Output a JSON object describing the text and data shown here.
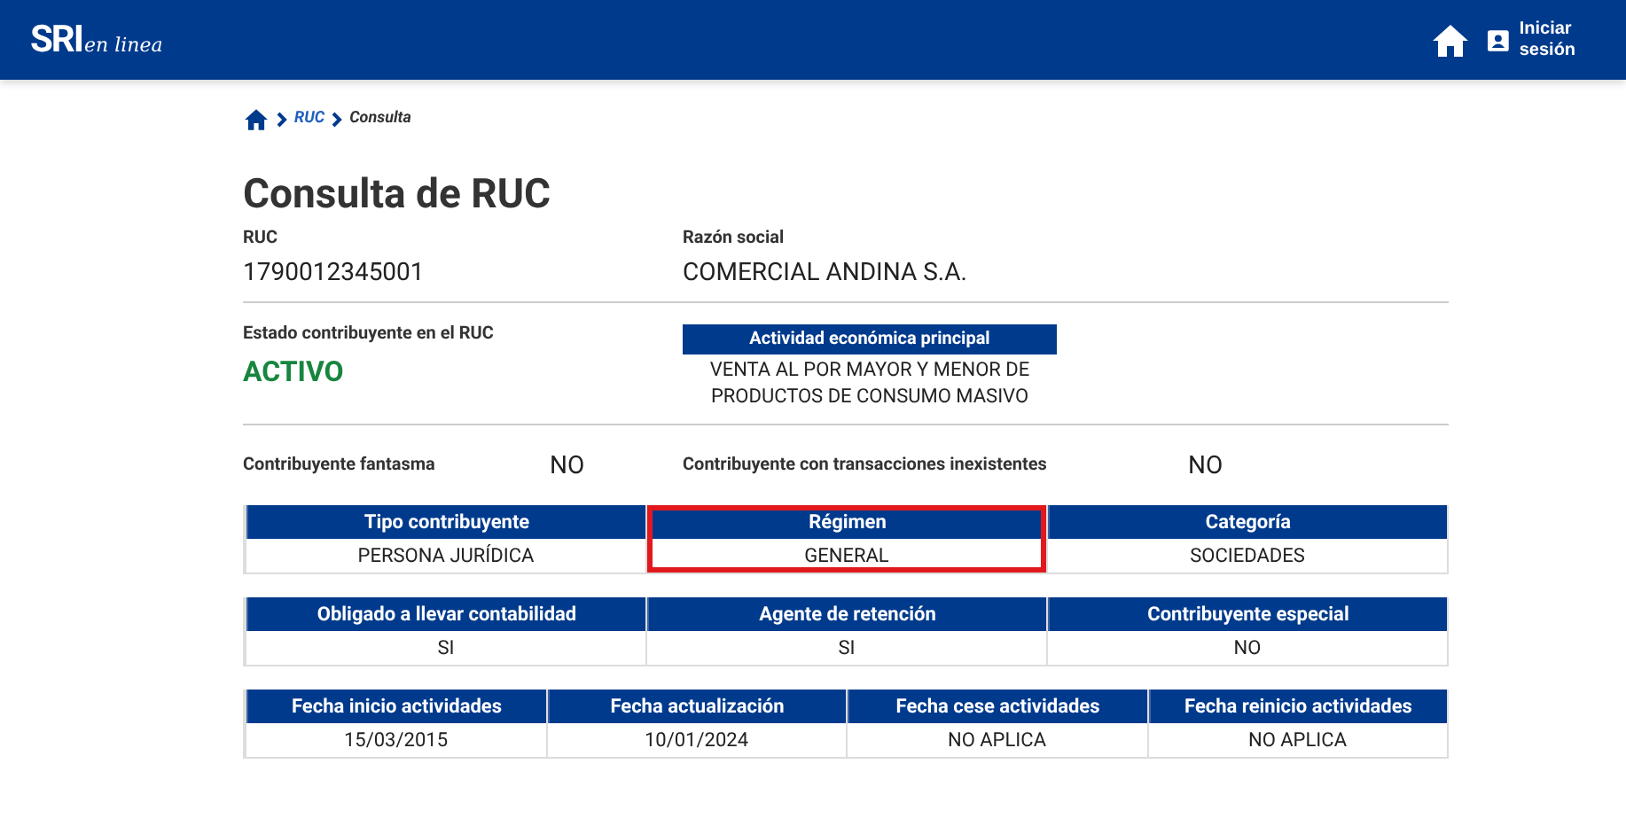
{
  "header": {
    "logo": "SRI",
    "logo_suffix": "en linea",
    "login": "Iniciar sesión"
  },
  "breadcrumb": [
    "RUC",
    "Consulta"
  ],
  "title": "Consulta de RUC",
  "ruc": {
    "label": "RUC",
    "value": "1790012345001"
  },
  "razon_social": {
    "label": "Razón social",
    "value": "COMERCIAL ANDINA S.A."
  },
  "estado": {
    "label": "Estado contribuyente en el RUC",
    "value": "ACTIVO"
  },
  "actividad": {
    "label": "Actividad económica principal",
    "value": "VENTA AL POR MAYOR Y MENOR DE PRODUCTOS DE CONSUMO MASIVO"
  },
  "flags": [
    {
      "label": "Contribuyente fantasma",
      "value": "NO"
    },
    {
      "label": "Contribuyente con transacciones inexistentes",
      "value": "NO"
    }
  ],
  "tables": [
    {
      "columns": [
        {
          "header": "Tipo contribuyente",
          "value": "PERSONA JURÍDICA",
          "highlighted": false
        },
        {
          "header": "Régimen",
          "value": "GENERAL",
          "highlighted": true
        },
        {
          "header": "Categoría",
          "value": "SOCIEDADES",
          "highlighted": false
        }
      ]
    },
    {
      "columns": [
        {
          "header": "Obligado a llevar contabilidad",
          "value": "SI",
          "highlighted": false
        },
        {
          "header": "Agente de retención",
          "value": "SI",
          "highlighted": false
        },
        {
          "header": "Contribuyente especial",
          "value": "NO",
          "highlighted": false
        }
      ]
    },
    {
      "columns": [
        {
          "header": "Fecha inicio actividades",
          "value": "15/03/2015",
          "highlighted": false
        },
        {
          "header": "Fecha actualización",
          "value": "10/01/2024",
          "highlighted": false
        },
        {
          "header": "Fecha cese actividades",
          "value": "NO APLICA",
          "highlighted": false
        },
        {
          "header": "Fecha reinicio actividades",
          "value": "NO APLICA",
          "highlighted": false
        }
      ]
    }
  ]
}
